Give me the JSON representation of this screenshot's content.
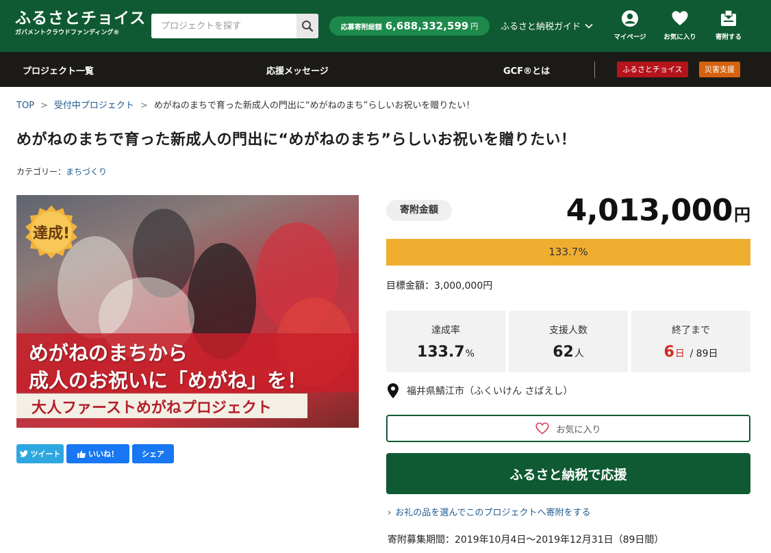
{
  "header": {
    "logo_main": "ふるさとチョイス",
    "logo_sub": "ガバメントクラウドファンディング®",
    "search_placeholder": "プロジェクトを探す",
    "total_label": "応募寄附総額",
    "total_value": "6,688,332,599",
    "total_unit": "円",
    "guide_label": "ふるさと納税ガイド",
    "icons": [
      {
        "name": "mypage",
        "label": "マイページ",
        "icon": "person-icon"
      },
      {
        "name": "favorites",
        "label": "お気に入り",
        "icon": "heart-icon"
      },
      {
        "name": "donate",
        "label": "寄附する",
        "icon": "donate-icon"
      }
    ]
  },
  "nav": {
    "items": [
      "プロジェクト一覧",
      "応援メッセージ",
      "GCF®とは"
    ],
    "badge_furusato": "ふるさとチョイス",
    "badge_disaster": "災害支援",
    "badge_colors": {
      "furusato": "#b5141c",
      "disaster": "#d4620e"
    }
  },
  "breadcrumb": {
    "top": "TOP",
    "accepting": "受付中プロジェクト",
    "current": "めがねのまちで育った新成人の門出に“めがねのまち”らしいお祝いを贈りたい！"
  },
  "project": {
    "title": "めがねのまちで育った新成人の門出に“めがねのまち”らしいお祝いを贈りたい！",
    "category_label": "カテゴリー：",
    "category_value": "まちづくり",
    "image": {
      "badge": "達成!",
      "line1": "めがねのまちから",
      "line2": "成人のお祝いに「めがね」を！",
      "banner": "大人ファーストめがねプロジェクト"
    }
  },
  "share": {
    "tweet": "ツイート",
    "like": "いいね！",
    "share": "シェア"
  },
  "stats": {
    "amount_label": "寄附金額",
    "amount": "4,013,000",
    "amount_unit": "円",
    "progress_rate": 1.337,
    "progress_text": "133.7%",
    "target": "目標金額：3,000,000円",
    "rate_label": "達成率",
    "rate_value": "133.7",
    "rate_unit": "%",
    "supporters_label": "支援人数",
    "supporters_value": "62",
    "supporters_unit": "人",
    "remaining_label": "終了まで",
    "remaining_days": "6",
    "remaining_unit": "日",
    "remaining_total": "/ 89日"
  },
  "location": "福井県鯖江市（ふくいけん さばえし）",
  "actions": {
    "favorite": "お気に入り",
    "support": "ふるさと納税で応援",
    "gift_link": "お礼の品を選んでこのプロジェクトへ寄附をする"
  },
  "period": "寄附募集期間：2019年10月4日～2019年12月31日（89日間）",
  "colors": {
    "brand_green": "#0f5a32",
    "accent_green": "#1d8a4b",
    "progress_orange": "#f0ae30",
    "remaining_red": "#d02a1f",
    "twitter_blue": "#2ea7e0",
    "facebook_blue": "#1877f2"
  }
}
